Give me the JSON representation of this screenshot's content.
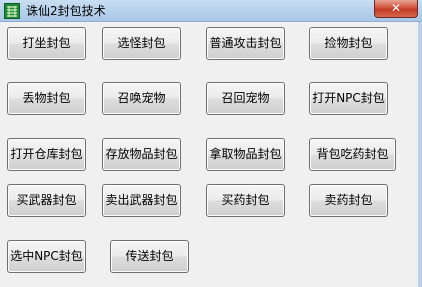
{
  "window": {
    "title": "诛仙2封包技术",
    "app_icon": "app-icon",
    "close_icon": "close-icon"
  },
  "buttons": [
    {
      "label": "打坐封包"
    },
    {
      "label": "选怪封包"
    },
    {
      "label": "普通攻击封包"
    },
    {
      "label": "捡物封包"
    },
    {
      "label": "丢物封包"
    },
    {
      "label": "召唤宠物"
    },
    {
      "label": "召回宠物"
    },
    {
      "label": "打开NPC封包"
    },
    {
      "label": "打开仓库封包"
    },
    {
      "label": "存放物品封包"
    },
    {
      "label": "拿取物品封包"
    },
    {
      "label": "背包吃药封包"
    },
    {
      "label": "买武器封包"
    },
    {
      "label": "卖出武器封包"
    },
    {
      "label": "买药封包"
    },
    {
      "label": "卖药封包"
    },
    {
      "label": "选中NPC封包"
    },
    {
      "label": "传送封包"
    }
  ]
}
